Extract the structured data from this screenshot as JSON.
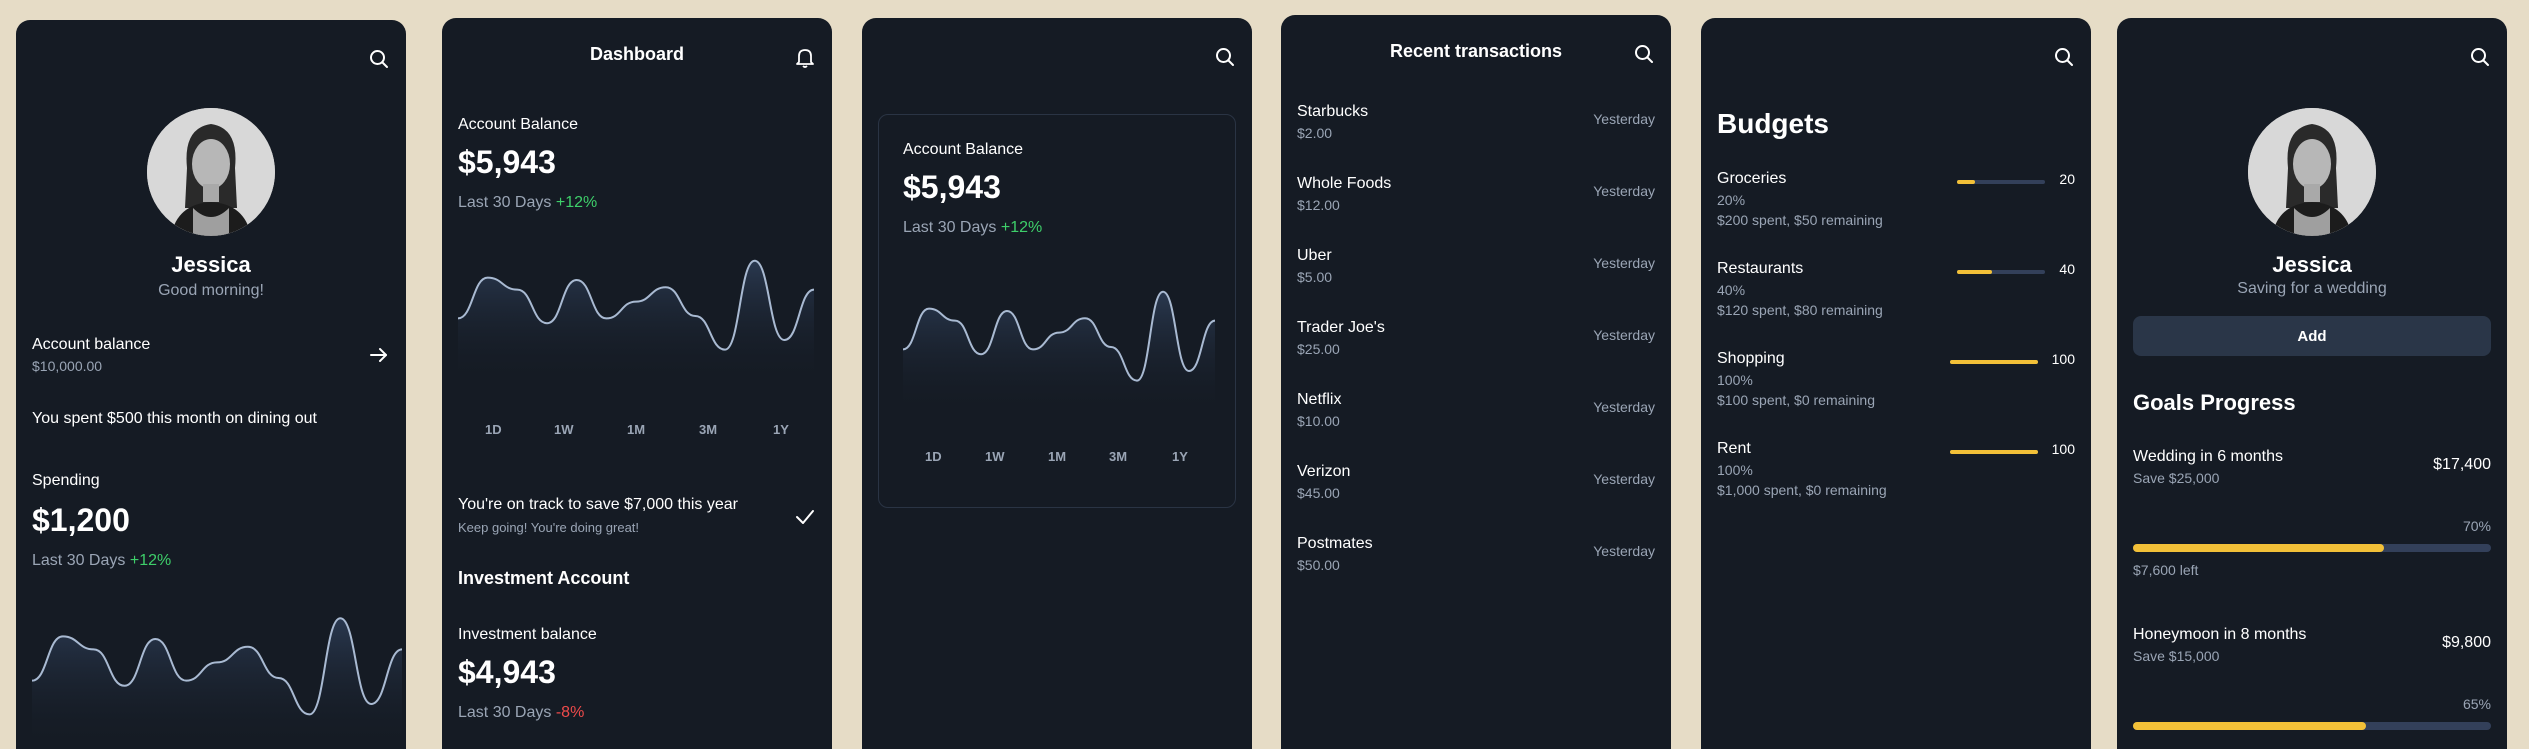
{
  "colors": {
    "page_bg": "#e6dcc6",
    "panel_bg": "#151b24",
    "accent": "#f2c038",
    "positive": "#3ecf6a",
    "negative": "#ef4b4b",
    "muted": "#9aa5b5",
    "line": "#a9bad2"
  },
  "profile": {
    "icons": {
      "search": "search-icon",
      "arrow": "arrow-right-icon"
    },
    "name": "Jessica",
    "greeting": "Good morning!",
    "account_label": "Account balance",
    "account_value": "$10,000.00",
    "insight": "You spent $500 this month on dining out",
    "spending_label": "Spending",
    "spending_value": "$1,200",
    "period": "Last 30 Days",
    "change": "+12%"
  },
  "dashboard": {
    "title": "Dashboard",
    "icons": {
      "bell": "bell-icon",
      "check": "check-icon"
    },
    "balance_label": "Account Balance",
    "balance_value": "$5,943",
    "period": "Last 30 Days",
    "change": "+12%",
    "ranges": [
      "1D",
      "1W",
      "1M",
      "3M",
      "1Y"
    ],
    "track_title": "You're on track to save $7,000 this year",
    "track_sub": "Keep going! You're doing great!",
    "investment_heading": "Investment Account",
    "investment_label": "Investment balance",
    "investment_value": "$4,943",
    "investment_period": "Last 30 Days",
    "investment_change": "-8%"
  },
  "balance_card": {
    "label": "Account Balance",
    "value": "$5,943",
    "period": "Last 30 Days",
    "change": "+12%",
    "ranges": [
      "1D",
      "1W",
      "1M",
      "3M",
      "1Y"
    ]
  },
  "transactions": {
    "title": "Recent transactions",
    "items": [
      {
        "name": "Starbucks",
        "amount": "$2.00",
        "date": "Yesterday"
      },
      {
        "name": "Whole Foods",
        "amount": "$12.00",
        "date": "Yesterday"
      },
      {
        "name": "Uber",
        "amount": "$5.00",
        "date": "Yesterday"
      },
      {
        "name": "Trader Joe's",
        "amount": "$25.00",
        "date": "Yesterday"
      },
      {
        "name": "Netflix",
        "amount": "$10.00",
        "date": "Yesterday"
      },
      {
        "name": "Verizon",
        "amount": "$45.00",
        "date": "Yesterday"
      },
      {
        "name": "Postmates",
        "amount": "$50.00",
        "date": "Yesterday"
      }
    ]
  },
  "budgets": {
    "title": "Budgets",
    "items": [
      {
        "name": "Groceries",
        "percent_label": "20%",
        "summary": "$200 spent, $50 remaining",
        "value": "20",
        "fraction": 0.2
      },
      {
        "name": "Restaurants",
        "percent_label": "40%",
        "summary": "$120 spent, $80 remaining",
        "value": "40",
        "fraction": 0.4
      },
      {
        "name": "Shopping",
        "percent_label": "100%",
        "summary": "$100 spent, $0 remaining",
        "value": "100",
        "fraction": 1.0
      },
      {
        "name": "Rent",
        "percent_label": "100%",
        "summary": "$1,000 spent, $0 remaining",
        "value": "100",
        "fraction": 1.0
      }
    ]
  },
  "goals": {
    "name": "Jessica",
    "subtitle": "Saving for a wedding",
    "add_label": "Add",
    "heading": "Goals Progress",
    "items": [
      {
        "name": "Wedding in 6 months",
        "target": "Save $25,000",
        "amount": "$17,400",
        "percent": "70%",
        "fraction": 0.7,
        "left": "$7,600 left"
      },
      {
        "name": "Honeymoon in 8 months",
        "target": "Save $15,000",
        "amount": "$9,800",
        "percent": "65%",
        "fraction": 0.65,
        "left": ""
      }
    ]
  }
}
